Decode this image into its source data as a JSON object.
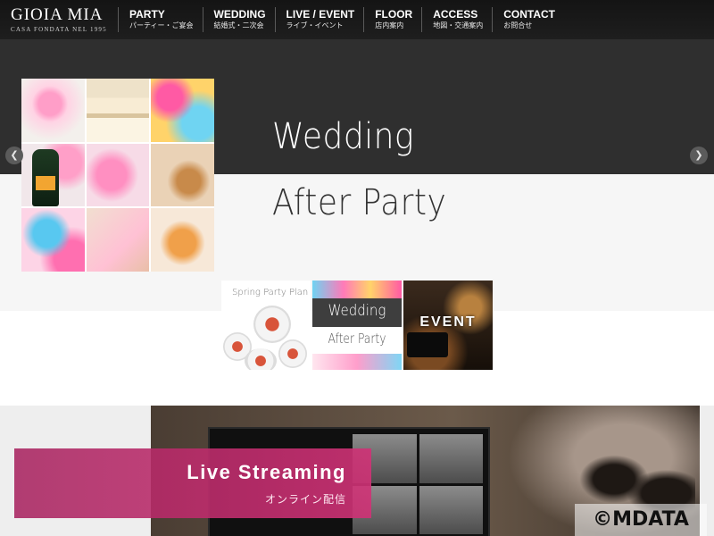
{
  "header": {
    "logo": {
      "main": "GIOIA MIA",
      "sub": "CASA FONDATA NEL 1995"
    },
    "nav": [
      {
        "en": "PARTY",
        "jp": "パーティー・ご宴会"
      },
      {
        "en": "WEDDING",
        "jp": "結婚式・二次会"
      },
      {
        "en": "LIVE / EVENT",
        "jp": "ライブ・イベント"
      },
      {
        "en": "FLOOR",
        "jp": "店内案内"
      },
      {
        "en": "ACCESS",
        "jp": "地図・交通案内"
      },
      {
        "en": "CONTACT",
        "jp": "お問合せ"
      }
    ]
  },
  "hero": {
    "title": "Wedding",
    "subtitle": "After Party",
    "prev_icon": "chevron-left-icon",
    "next_icon": "chevron-right-icon"
  },
  "thumbnails": [
    {
      "title": "Spring Party Plan"
    },
    {
      "title": "Wedding",
      "subtitle": "After Party"
    },
    {
      "title": "EVENT"
    }
  ],
  "live": {
    "title": "Live Streaming",
    "subtitle": "オンライン配信"
  },
  "copyright": "©MDATA",
  "colors": {
    "header_bg": "#1a1a1a",
    "hero_dark": "#2f2f2f",
    "hero_light": "#f6f6f6",
    "live_banner": "#b8286c"
  }
}
